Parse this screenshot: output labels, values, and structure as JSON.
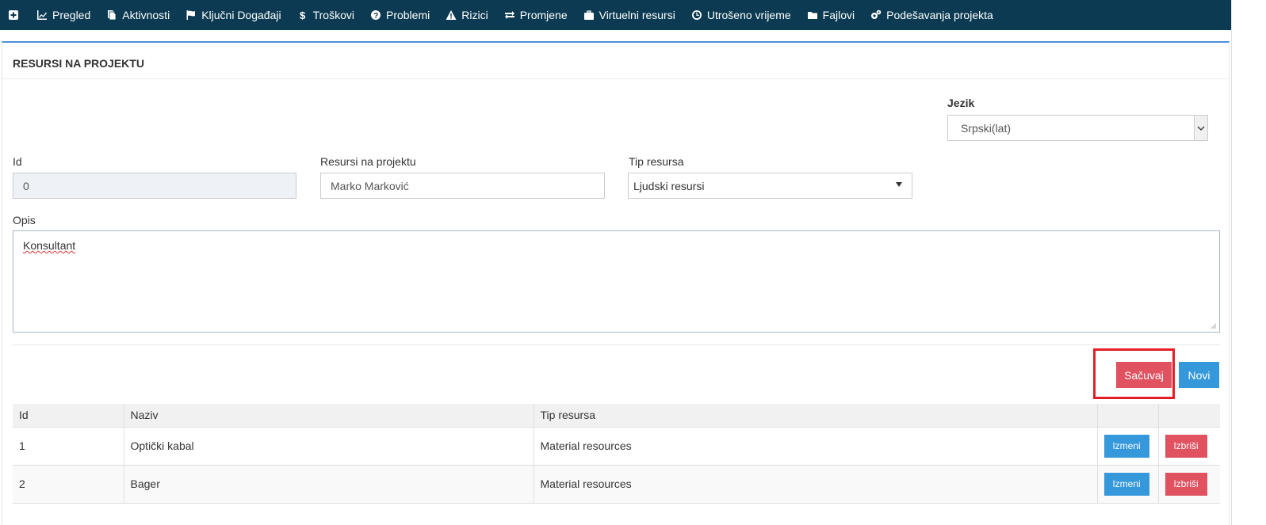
{
  "nav": {
    "items": [
      {
        "label": "",
        "icon": "plus-square-icon"
      },
      {
        "label": "Pregled",
        "icon": "line-chart-icon"
      },
      {
        "label": "Aktivnosti",
        "icon": "copy-icon"
      },
      {
        "label": "Ključni Događaji",
        "icon": "flag-icon"
      },
      {
        "label": "Troškovi",
        "icon": "dollar-icon"
      },
      {
        "label": "Problemi",
        "icon": "question-circle-icon"
      },
      {
        "label": "Rizici",
        "icon": "warning-icon"
      },
      {
        "label": "Promjene",
        "icon": "exchange-icon"
      },
      {
        "label": "Virtuelni resursi",
        "icon": "briefcase-icon"
      },
      {
        "label": "Utrošeno vrijeme",
        "icon": "clock-icon"
      },
      {
        "label": "Fajlovi",
        "icon": "folder-icon"
      },
      {
        "label": "Podešavanja projekta",
        "icon": "cogs-icon"
      }
    ],
    "background": "#0b3a52"
  },
  "panel": {
    "title": "RESURSI NA PROJEKTU"
  },
  "form": {
    "language_label": "Jezik",
    "language_value": "Srpski(lat)",
    "id_label": "Id",
    "id_value": "0",
    "name_label": "Resursi na projektu",
    "name_value": "Marko Marković",
    "type_label": "Tip resursa",
    "type_value": "Ljudski resursi",
    "desc_label": "Opis",
    "desc_value": "Konsultant"
  },
  "buttons": {
    "save": "Sačuvaj",
    "new": "Novi"
  },
  "table": {
    "headers": [
      "Id",
      "Naziv",
      "Tip resursa",
      "",
      ""
    ],
    "rows": [
      {
        "id": "1",
        "name": "Optički kabal",
        "type": "Material resources",
        "edit": "Izmeni",
        "delete": "Izbriši"
      },
      {
        "id": "2",
        "name": "Bager",
        "type": "Material resources",
        "edit": "Izmeni",
        "delete": "Izbriši"
      }
    ]
  },
  "colors": {
    "accent_blue": "#3498db",
    "accent_red": "#e05260",
    "highlight_box": "#e41e26"
  }
}
